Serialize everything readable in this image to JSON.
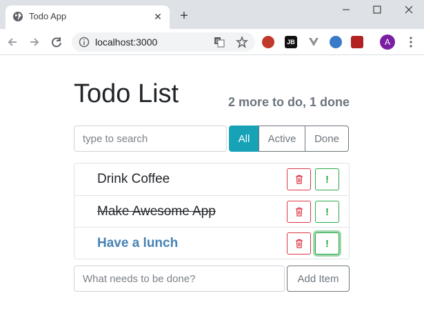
{
  "browser": {
    "tab_title": "Todo App",
    "url": "localhost:3000",
    "avatar_initial": "A",
    "extensions": [
      {
        "icon": "ext-red-circle-icon",
        "label": ""
      },
      {
        "icon": "jetbrains-icon",
        "label": "JB"
      },
      {
        "icon": "vue-devtools-icon",
        "label": ""
      },
      {
        "icon": "blue-circle-ext-icon",
        "label": ""
      },
      {
        "icon": "red-square-ext-icon",
        "label": ""
      }
    ]
  },
  "app": {
    "title": "Todo List",
    "count_text": "2 more to do, 1 done",
    "search": {
      "placeholder": "type to search"
    },
    "filters": [
      {
        "label": "All",
        "active": true
      },
      {
        "label": "Active",
        "active": false
      },
      {
        "label": "Done",
        "active": false
      }
    ],
    "todos": [
      {
        "label": "Drink Coffee",
        "done": false,
        "important": false
      },
      {
        "label": "Make Awesome App",
        "done": true,
        "important": false
      },
      {
        "label": "Have a lunch",
        "done": false,
        "important": true
      }
    ],
    "important_label": "!",
    "add": {
      "placeholder": "What needs to be done?",
      "button_label": "Add Item"
    }
  },
  "colors": {
    "primary_info": "#17a2b8",
    "danger": "#dc3545",
    "success": "#28a745",
    "important_text": "#4682b4",
    "muted": "#6c757d"
  }
}
